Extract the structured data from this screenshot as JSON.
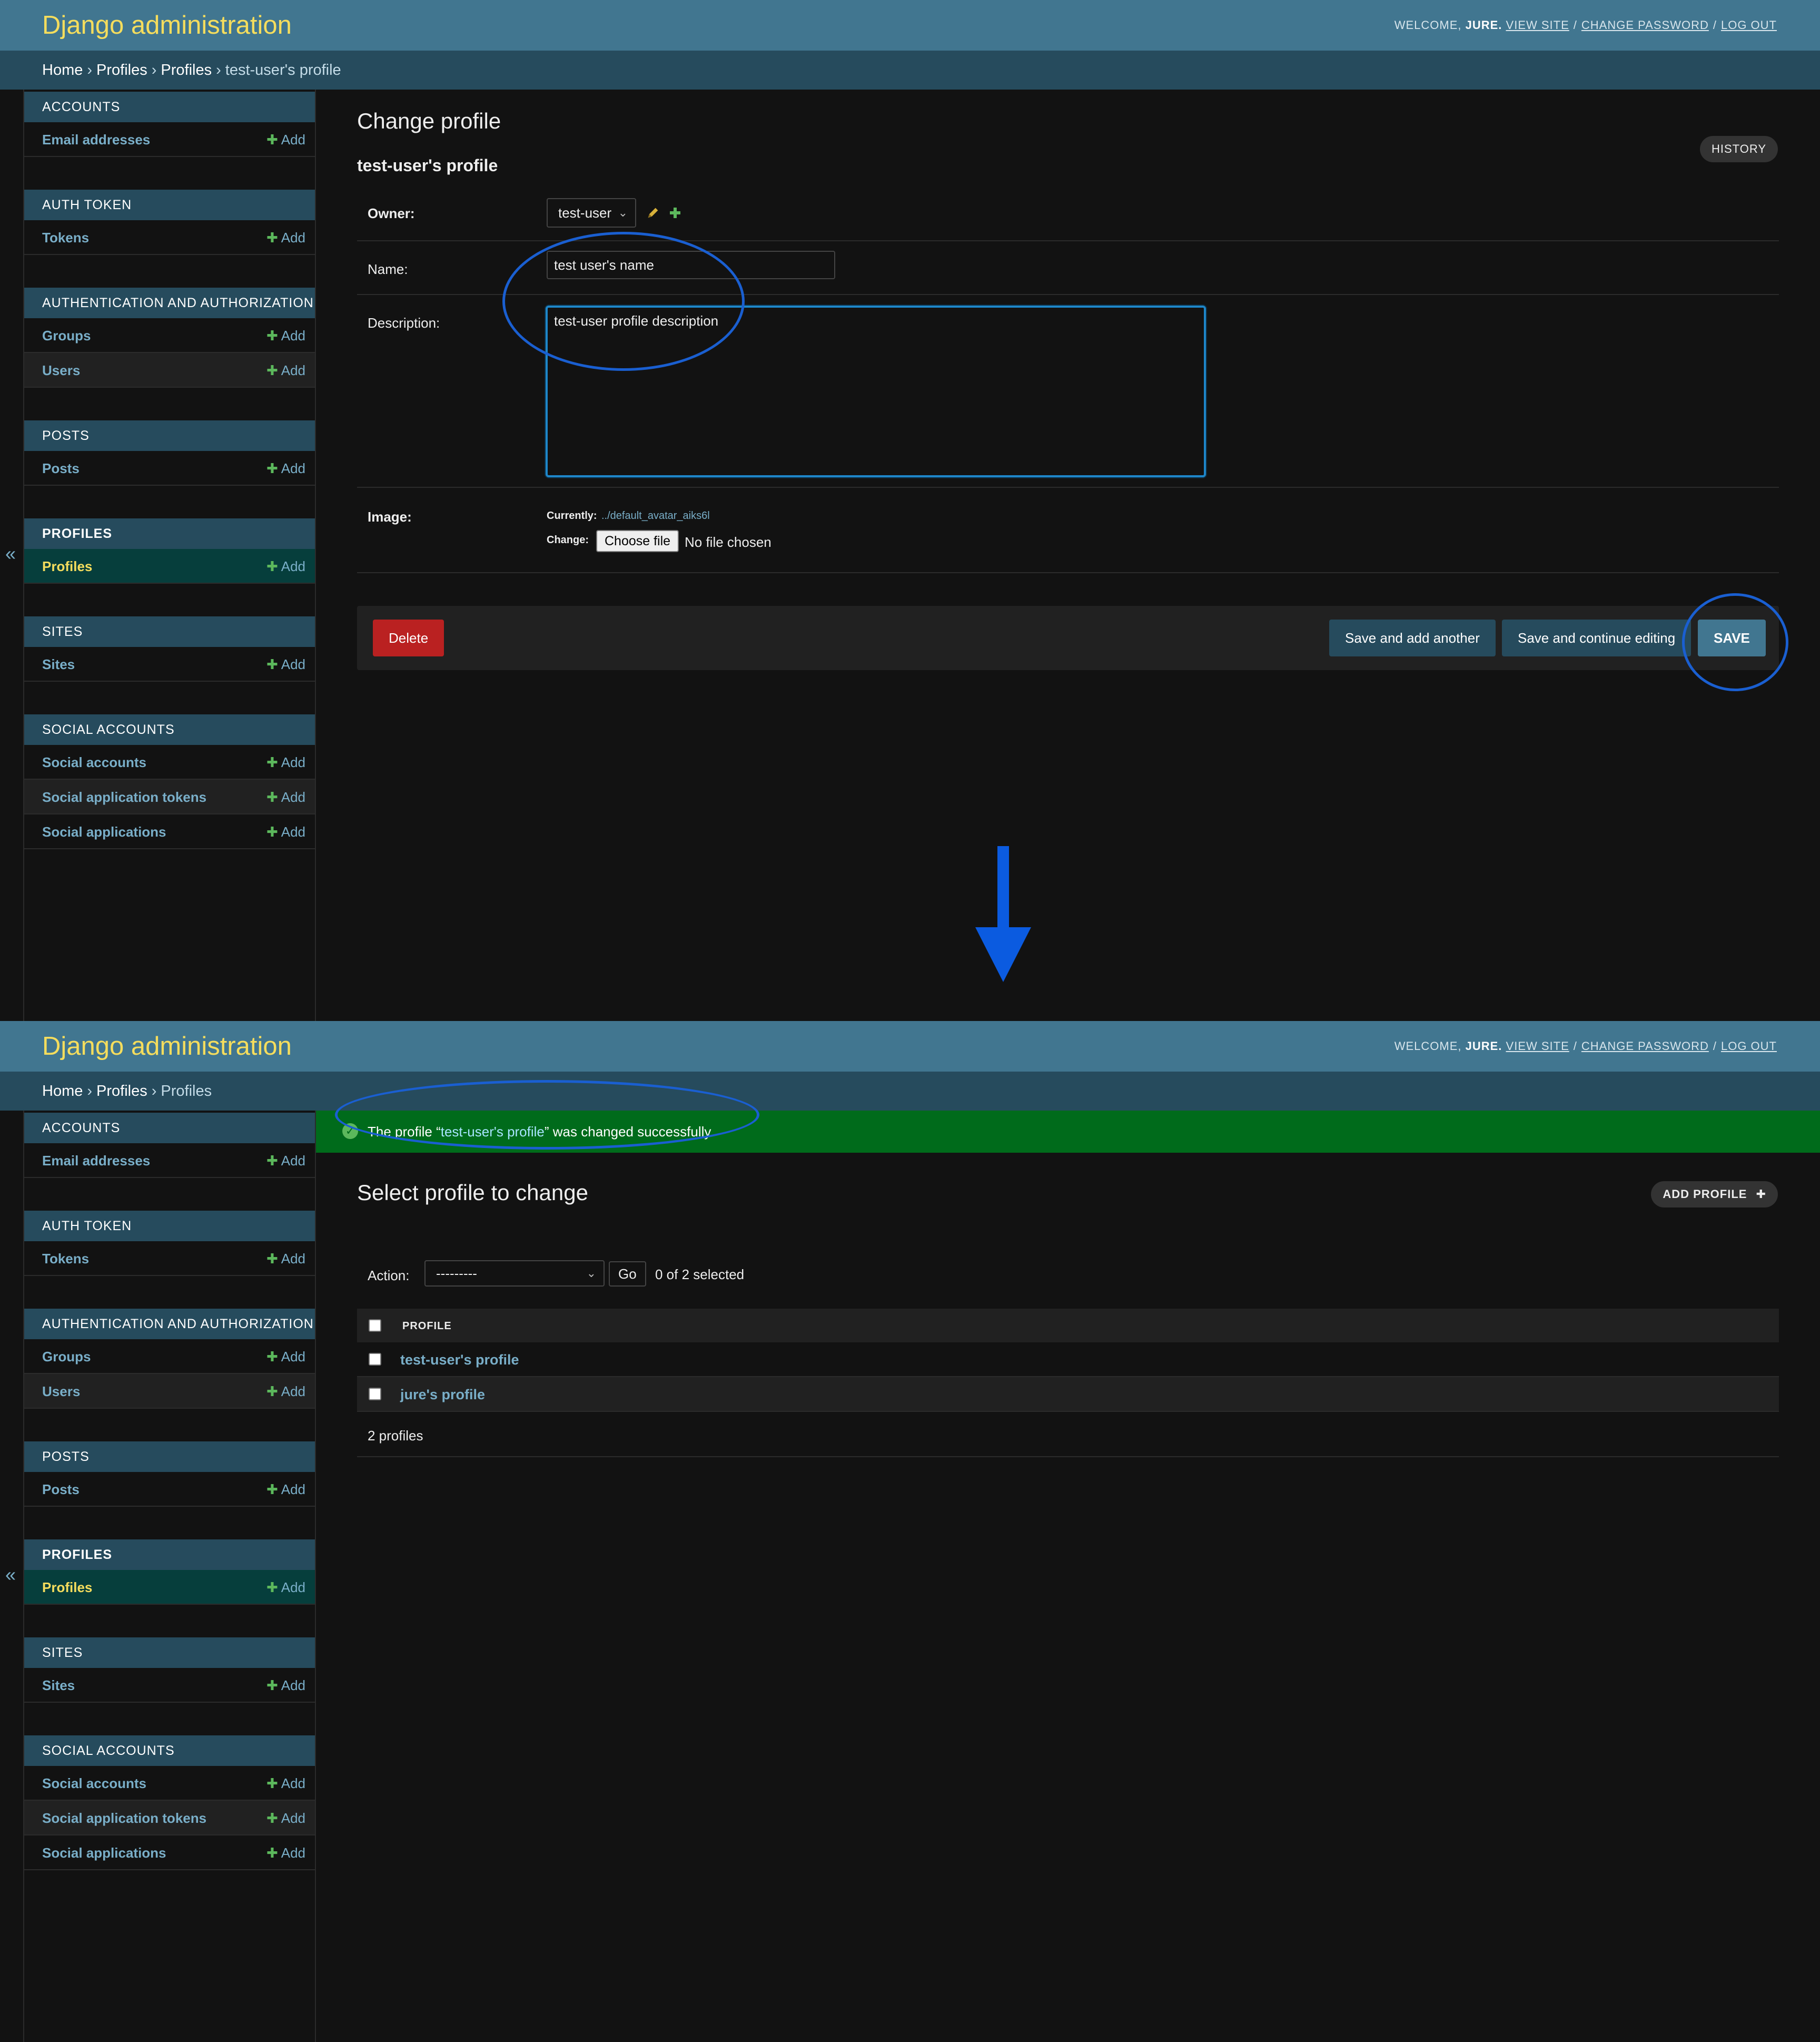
{
  "header": {
    "brand": "Django administration",
    "welcome": "WELCOME,",
    "username": "JURE.",
    "view_site": "VIEW SITE",
    "change_password": "CHANGE PASSWORD",
    "log_out": "LOG OUT",
    "separator": "/"
  },
  "nav_toggle": "«",
  "sidebar": {
    "add_label": "Add",
    "modules": [
      {
        "title": "ACCOUNTS",
        "items": [
          "Email addresses"
        ]
      },
      {
        "title": "AUTH TOKEN",
        "items": [
          "Tokens"
        ]
      },
      {
        "title": "AUTHENTICATION AND AUTHORIZATION",
        "items": [
          "Groups",
          "Users"
        ]
      },
      {
        "title": "POSTS",
        "items": [
          "Posts"
        ]
      },
      {
        "title": "PROFILES",
        "items": [
          "Profiles"
        ]
      },
      {
        "title": "SITES",
        "items": [
          "Sites"
        ]
      },
      {
        "title": "SOCIAL ACCOUNTS",
        "items": [
          "Social accounts",
          "Social application tokens",
          "Social applications"
        ]
      }
    ]
  },
  "top": {
    "breadcrumbs": [
      "Home",
      "Profiles",
      "Profiles",
      "test-user's profile"
    ],
    "breadcrumb_sep": "›",
    "title": "Change profile",
    "subtitle": "test-user's profile",
    "history": "HISTORY",
    "owner": {
      "label": "Owner:",
      "value": "test-user"
    },
    "name": {
      "label": "Name:",
      "value": "test user's name"
    },
    "description": {
      "label": "Description:",
      "value": "test-user profile description"
    },
    "image": {
      "label": "Image:",
      "currently_label": "Currently:",
      "currently_value": "../default_avatar_aiks6l",
      "change_label": "Change:",
      "choose_file": "Choose file",
      "no_file": "No file chosen"
    },
    "buttons": {
      "delete": "Delete",
      "save_add_another": "Save and add another",
      "save_continue": "Save and continue editing",
      "save": "SAVE"
    }
  },
  "bottom": {
    "breadcrumbs": [
      "Home",
      "Profiles",
      "Profiles"
    ],
    "breadcrumb_sep": "›",
    "message": {
      "prefix": "The profile “",
      "link": "test-user's profile",
      "suffix": "” was changed successfully."
    },
    "title": "Select profile to change",
    "add_profile": "ADD PROFILE",
    "add_icon": "✚",
    "action_label": "Action:",
    "action_value": "---------",
    "go": "Go",
    "selected_count": "0 of 2 selected",
    "column_header": "PROFILE",
    "rows": [
      "test-user's profile",
      "jure's profile"
    ],
    "result_count": "2 profiles"
  },
  "colors": {
    "header": "#417690",
    "brand": "#f5dd5d",
    "breadcrumb_bar": "#264b5d",
    "link": "#79aec8",
    "success": "#006b1b",
    "delete": "#ba2121",
    "annotation": "#1a5fd1"
  },
  "icons": {
    "edit": "pencil-icon",
    "add": "plus-icon",
    "success": "checkmark-icon",
    "dropdown": "chevron-down-icon"
  }
}
